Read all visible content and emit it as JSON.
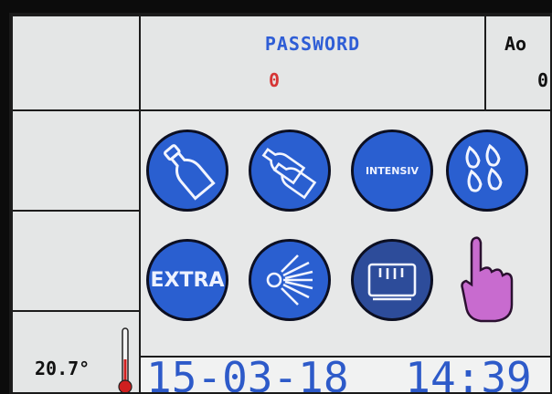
{
  "header": {
    "password_title": "PASSWORD",
    "password_value": "0",
    "ao_title": "Ao",
    "ao_value": "0"
  },
  "temperature": {
    "value": "20.7°"
  },
  "buttons": [
    {
      "icon": "single-bottle-icon"
    },
    {
      "icon": "multiple-bottles-icon"
    },
    {
      "label": "INTENSIV"
    },
    {
      "icon": "water-drops-icon"
    },
    {
      "label": "EXTRA"
    },
    {
      "icon": "spray-burst-icon"
    },
    {
      "icon": "steam-chamber-icon"
    },
    {
      "icon": "pointing-hand-icon"
    }
  ],
  "datetime": {
    "date": "15-03-18",
    "time": "14:39"
  },
  "colors": {
    "button_blue": "#2a5fd0",
    "title_blue": "#2f5ed6",
    "value_red": "#d63535",
    "hand_pink": "#c86bcf",
    "thermometer_red": "#cf1f1f"
  }
}
